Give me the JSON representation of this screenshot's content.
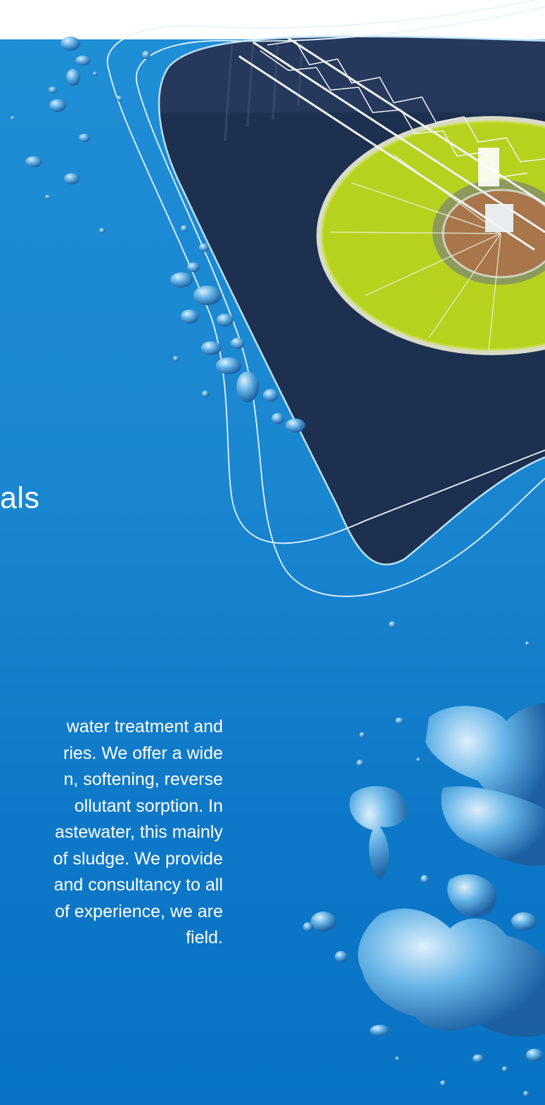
{
  "hero": {
    "heading_partial": "als",
    "image_label": "wastewater-clarifier-photo"
  },
  "body": {
    "lines": [
      "water treatment and",
      "ries. We offer a wide",
      "n, softening, reverse",
      "ollutant sorption. In",
      "astewater, this mainly",
      "of sludge. We provide",
      "and consultancy to all",
      "of experience, we are",
      "field."
    ]
  },
  "colors": {
    "background_top": "#1f8fd6",
    "background_bottom": "#0873c4",
    "top_bar": "#ffffff",
    "text": "#ffffff",
    "photo_water": "#1e3050",
    "algae_green": "#b4d31e"
  }
}
